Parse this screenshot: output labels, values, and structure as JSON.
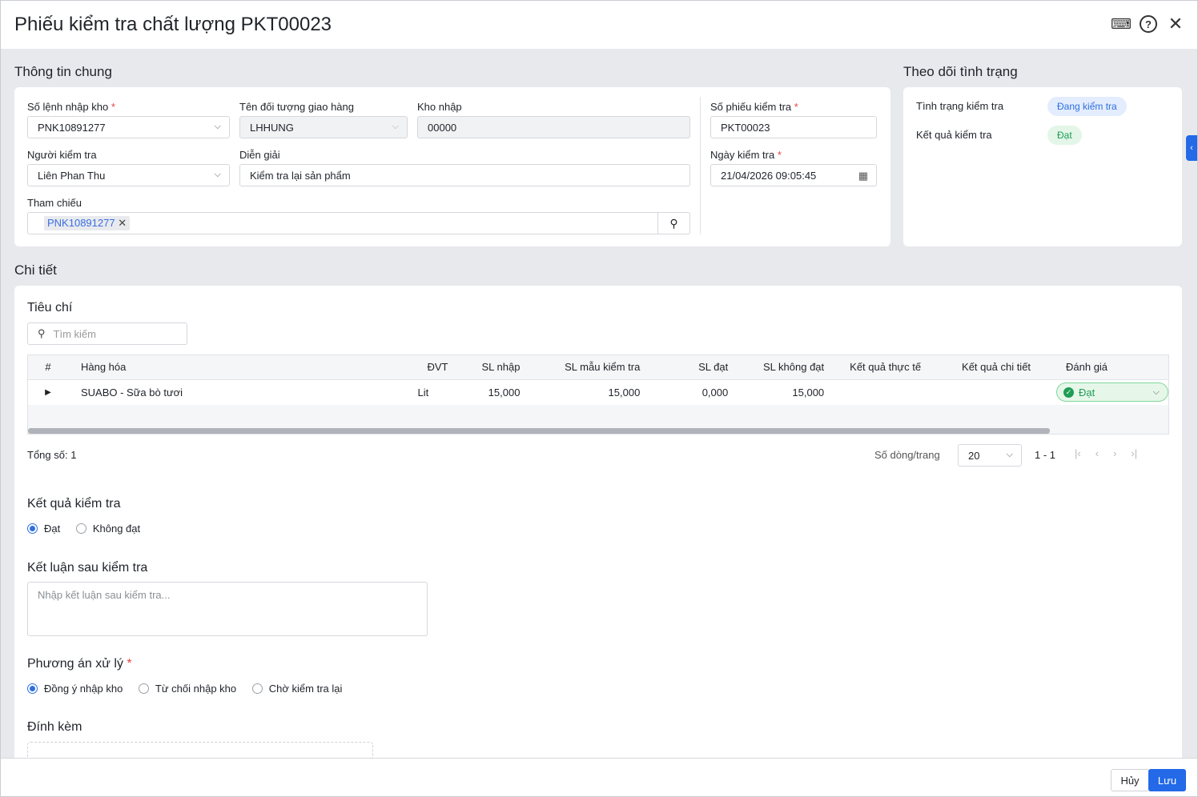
{
  "title": "Phiếu kiểm tra chất lượng PKT00023",
  "general": {
    "title": "Thông tin chung",
    "so_lenh_label": "Số lệnh nhập kho",
    "so_lenh_value": "PNK10891277",
    "doi_tuong_label": "Tên đối tượng giao hàng",
    "doi_tuong_value": "LHHUNG",
    "kho_label": "Kho nhập",
    "kho_value": "00000",
    "nguoi_label": "Người kiểm tra",
    "nguoi_value": "Liên Phan Thu",
    "dien_giai_label": "Diễn giải",
    "dien_giai_value": "Kiểm tra lại sản phẩm",
    "tham_chieu_label": "Tham chiếu",
    "tham_chieu_tag": "PNK10891277",
    "so_phieu_label": "Số phiếu kiểm tra",
    "so_phieu_value": "PKT00023",
    "ngay_label": "Ngày kiểm tra",
    "ngay_value": "21/04/2026 09:05:45",
    "required_mark": "*"
  },
  "status": {
    "title": "Theo dõi tình trạng",
    "tinh_trang_label": "Tình trạng kiểm tra",
    "tinh_trang_value": "Đang kiểm tra",
    "ket_qua_label": "Kết quả kiểm tra",
    "ket_qua_value": "Đạt"
  },
  "detail": {
    "title": "Chi tiết",
    "criteria_title": "Tiêu chí",
    "search_placeholder": "Tìm kiếm",
    "columns": [
      "#",
      "Hàng hóa",
      "ĐVT",
      "SL nhập",
      "SL mẫu kiểm tra",
      "SL đạt",
      "SL không đạt",
      "Kết quả thực tế",
      "Kết quả chi tiết",
      "Đánh giá"
    ],
    "rows": [
      {
        "hang_hoa": "SUABO - Sữa bò tươi",
        "dvt": "Lit",
        "sl_nhap": "15,000",
        "sl_mau": "15,000",
        "sl_dat": "0,000",
        "sl_khong_dat": "15,000",
        "kq_thuc_te": "",
        "kq_chi_tiet": "",
        "danh_gia": "Đạt"
      }
    ],
    "total_label": "Tổng số:",
    "total_value": "1",
    "rows_per_page_label": "Số dòng/trang",
    "rows_per_page": "20",
    "range": "1 - 1"
  },
  "result": {
    "title": "Kết quả kiểm tra",
    "options": [
      "Đạt",
      "Không đạt"
    ],
    "selected": 0
  },
  "conclusion": {
    "title": "Kết luận sau kiểm tra",
    "placeholder": "Nhập kết luận sau kiểm tra..."
  },
  "action": {
    "title": "Phương án xử lý",
    "options": [
      "Đồng ý nhập kho",
      "Từ chối nhập kho",
      "Chờ kiểm tra lại"
    ],
    "selected": 0
  },
  "attach": {
    "title": "Đính kèm"
  },
  "footer": {
    "cancel": "Hủy",
    "save": "Lưu"
  },
  "colors": {
    "primary": "#2369e8",
    "success": "#1f9d55"
  }
}
